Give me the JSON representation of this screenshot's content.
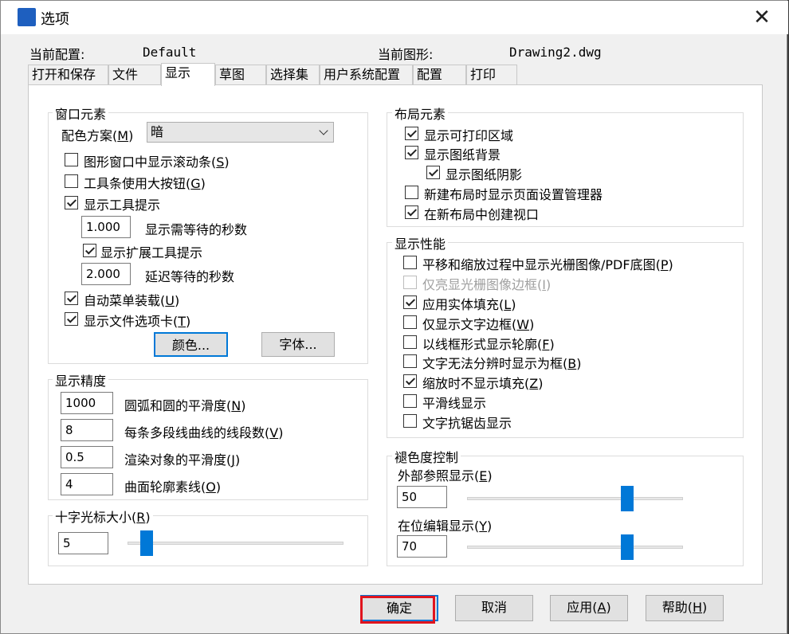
{
  "window": {
    "title": "选项",
    "close_glyph": "✕"
  },
  "config": {
    "current_profile_label": "当前配置:",
    "current_profile_value": "Default",
    "current_drawing_label": "当前图形:",
    "current_drawing_value": "Drawing2.dwg"
  },
  "tabs": [
    "打开和保存",
    "文件",
    "显示",
    "草图",
    "选择集",
    "用户系统配置",
    "配置",
    "打印"
  ],
  "window_elements": {
    "title": "窗口元素",
    "color_scheme_label": "配色方案",
    "color_scheme_key": "M",
    "color_scheme_value": "暗",
    "cb_scrollbars": {
      "text": "图形窗口中显示滚动条",
      "key": "S",
      "checked": false
    },
    "cb_large_buttons": {
      "text": "工具条使用大按钮",
      "key": "G",
      "checked": false
    },
    "cb_tooltips": {
      "text": "显示工具提示",
      "checked": true
    },
    "tooltip_delay_value": "1.000",
    "tooltip_delay_label": "显示需等待的秒数",
    "cb_ext_tooltips": {
      "text": "显示扩展工具提示",
      "checked": true
    },
    "ext_delay_value": "2.000",
    "ext_delay_label": "延迟等待的秒数",
    "cb_auto_menu": {
      "text": "自动菜单装载",
      "key": "U",
      "checked": true
    },
    "cb_file_tabs": {
      "text": "显示文件选项卡",
      "key": "T",
      "checked": true
    },
    "colors_button": "颜色...",
    "fonts_button": "字体..."
  },
  "precision": {
    "title": "显示精度",
    "arc_value": "1000",
    "arc_label": "圆弧和圆的平滑度",
    "arc_key": "N",
    "polyline_value": "8",
    "polyline_label": "每条多段线曲线的线段数",
    "polyline_key": "V",
    "render_value": "0.5",
    "render_label": "渲染对象的平滑度",
    "render_key": "J",
    "contour_value": "4",
    "contour_label": "曲面轮廓素线",
    "contour_key": "O"
  },
  "crosshair": {
    "title": "十字光标大小",
    "key": "R",
    "value": "5",
    "slider_fraction": 0.06
  },
  "layout_elements": {
    "title": "布局元素",
    "items": [
      {
        "text": "显示可打印区域",
        "checked": true
      },
      {
        "text": "显示图纸背景",
        "checked": true
      },
      {
        "text": "显示图纸阴影",
        "checked": true
      },
      {
        "text": "新建布局时显示页面设置管理器",
        "checked": false
      },
      {
        "text": "在新布局中创建视口",
        "checked": true
      }
    ]
  },
  "performance": {
    "title": "显示性能",
    "items": [
      {
        "text": "平移和缩放过程中显示光栅图像/PDF底图",
        "key": "P",
        "checked": false,
        "disabled": false
      },
      {
        "text": "仅亮显光栅图像边框",
        "key": "I",
        "checked": false,
        "disabled": true
      },
      {
        "text": "应用实体填充",
        "key": "L",
        "checked": true,
        "disabled": false
      },
      {
        "text": "仅显示文字边框",
        "key": "W",
        "checked": false,
        "disabled": false
      },
      {
        "text": "以线框形式显示轮廓",
        "key": "F",
        "checked": false,
        "disabled": false
      },
      {
        "text": "文字无法分辨时显示为框",
        "key": "B",
        "checked": false,
        "disabled": false
      },
      {
        "text": "缩放时不显示填充",
        "key": "Z",
        "checked": true,
        "disabled": false
      },
      {
        "text": "平滑线显示",
        "key": "",
        "checked": false,
        "disabled": false
      },
      {
        "text": "文字抗锯齿显示",
        "key": "",
        "checked": false,
        "disabled": false
      }
    ]
  },
  "fade": {
    "title": "褪色度控制",
    "xref_label": "外部参照显示",
    "xref_key": "E",
    "xref_value": "50",
    "xref_fraction": 0.76,
    "inplace_label": "在位编辑显示",
    "inplace_key": "Y",
    "inplace_value": "70",
    "inplace_fraction": 0.76
  },
  "buttons": {
    "ok": "确定",
    "cancel": "取消",
    "apply": "应用",
    "apply_key": "A",
    "help": "帮助",
    "help_key": "H"
  }
}
